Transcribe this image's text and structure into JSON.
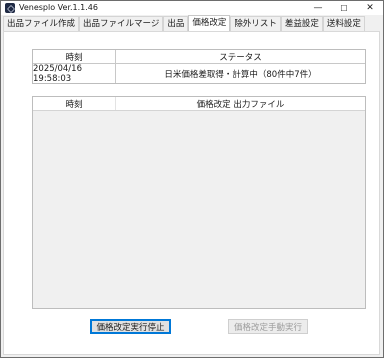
{
  "window": {
    "title": "Venesplo Ver.1.1.46"
  },
  "controls": {
    "minimize": "—",
    "maximize": "☐",
    "close": "✕"
  },
  "tabs": [
    {
      "label": "出品ファイル作成"
    },
    {
      "label": "出品ファイルマージ"
    },
    {
      "label": "出品"
    },
    {
      "label": "価格改定"
    },
    {
      "label": "除外リスト"
    },
    {
      "label": "差益設定"
    },
    {
      "label": "送料設定"
    }
  ],
  "status_table": {
    "headers": [
      "時刻",
      "ステータス"
    ],
    "row": {
      "time": "2025/04/16 19:58:03",
      "status": "日米価格差取得・計算中（80件中7件）"
    }
  },
  "output_list": {
    "headers": [
      "時刻",
      "価格改定 出力ファイル"
    ]
  },
  "buttons": {
    "stop": "価格改定実行停止",
    "manual": "価格改定手動実行"
  }
}
